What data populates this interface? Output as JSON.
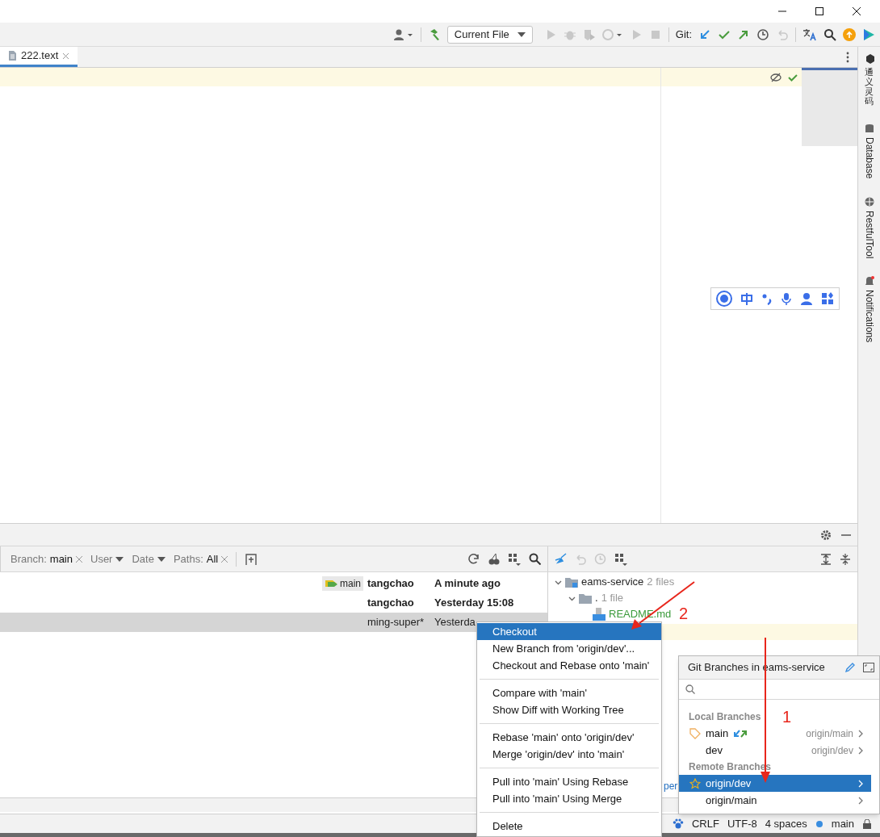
{
  "toolbar": {
    "run_config": "Current File",
    "git_label": "Git:"
  },
  "editor_tabs": [
    {
      "label": "222.text",
      "selected": true
    }
  ],
  "right_tool_strip": [
    {
      "label": "通义灵码",
      "kind": "cjk"
    },
    {
      "label": "Database",
      "kind": "latin"
    },
    {
      "label": "RestfulTool",
      "kind": "latin"
    },
    {
      "label": "Notifications",
      "kind": "latin"
    }
  ],
  "log_filters": [
    {
      "kind": "value",
      "label": "Branch:",
      "value": "main"
    },
    {
      "kind": "dropdown",
      "label": "User"
    },
    {
      "kind": "dropdown",
      "label": "Date"
    },
    {
      "kind": "value",
      "label": "Paths:",
      "value": "All"
    }
  ],
  "commits": [
    {
      "tag": "main",
      "author": "tangchao",
      "date": "A minute ago",
      "bold": true,
      "selected": false
    },
    {
      "author": "tangchao",
      "date": "Yesterday 15:08",
      "bold": true,
      "selected": false
    },
    {
      "author": "ming-super*",
      "date": "Yesterda",
      "bold": false,
      "selected": true
    }
  ],
  "changes_tree": [
    {
      "label": "eams-service",
      "count": "2 files",
      "kind": "module",
      "expanded": true,
      "children": [
        {
          "label": ".",
          "count": "1 file",
          "kind": "folder",
          "expanded": true,
          "children": [
            {
              "label": "README.md",
              "kind": "file"
            }
          ]
        }
      ]
    }
  ],
  "partial_text": "per",
  "context_menu": [
    [
      {
        "label": "Checkout",
        "selected": true
      },
      {
        "label": "New Branch from 'origin/dev'...",
        "selected": false
      },
      {
        "label": "Checkout and Rebase onto 'main'",
        "selected": false
      }
    ],
    [
      {
        "label": "Compare with 'main'",
        "selected": false
      },
      {
        "label": "Show Diff with Working Tree",
        "selected": false
      }
    ],
    [
      {
        "label": "Rebase 'main' onto 'origin/dev'",
        "selected": false
      },
      {
        "label": "Merge 'origin/dev' into 'main'",
        "selected": false
      }
    ],
    [
      {
        "label": "Pull into 'main' Using Rebase",
        "selected": false
      },
      {
        "label": "Pull into 'main' Using Merge",
        "selected": false
      }
    ],
    [
      {
        "label": "Delete",
        "selected": false
      }
    ]
  ],
  "branches_popup": {
    "title": "Git Branches in eams-service",
    "sections": [
      {
        "title": "Local Branches",
        "items": [
          {
            "name": "main",
            "tracking": "origin/main",
            "kind": "current",
            "selected": false
          },
          {
            "name": "dev",
            "tracking": "origin/dev",
            "kind": "plain",
            "selected": false
          }
        ]
      },
      {
        "title": "Remote Branches",
        "items": [
          {
            "name": "origin/dev",
            "kind": "favorite",
            "selected": true
          },
          {
            "name": "origin/main",
            "kind": "plain",
            "selected": false
          }
        ]
      }
    ]
  },
  "status_bar": [
    "CRLF",
    "UTF-8",
    "4 spaces",
    "main"
  ],
  "annotations": [
    {
      "label": "2"
    },
    {
      "label": "1"
    }
  ]
}
